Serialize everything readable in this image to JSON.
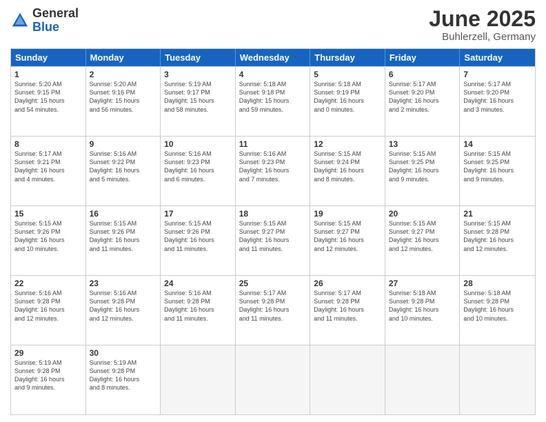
{
  "logo": {
    "general": "General",
    "blue": "Blue"
  },
  "title": "June 2025",
  "location": "Buhlerzell, Germany",
  "days_of_week": [
    "Sunday",
    "Monday",
    "Tuesday",
    "Wednesday",
    "Thursday",
    "Friday",
    "Saturday"
  ],
  "weeks": [
    [
      {
        "day": 1,
        "info": "Sunrise: 5:20 AM\nSunset: 9:15 PM\nDaylight: 15 hours\nand 54 minutes."
      },
      {
        "day": 2,
        "info": "Sunrise: 5:20 AM\nSunset: 9:16 PM\nDaylight: 15 hours\nand 56 minutes."
      },
      {
        "day": 3,
        "info": "Sunrise: 5:19 AM\nSunset: 9:17 PM\nDaylight: 15 hours\nand 58 minutes."
      },
      {
        "day": 4,
        "info": "Sunrise: 5:18 AM\nSunset: 9:18 PM\nDaylight: 15 hours\nand 59 minutes."
      },
      {
        "day": 5,
        "info": "Sunrise: 5:18 AM\nSunset: 9:19 PM\nDaylight: 16 hours\nand 0 minutes."
      },
      {
        "day": 6,
        "info": "Sunrise: 5:17 AM\nSunset: 9:20 PM\nDaylight: 16 hours\nand 2 minutes."
      },
      {
        "day": 7,
        "info": "Sunrise: 5:17 AM\nSunset: 9:20 PM\nDaylight: 16 hours\nand 3 minutes."
      }
    ],
    [
      {
        "day": 8,
        "info": "Sunrise: 5:17 AM\nSunset: 9:21 PM\nDaylight: 16 hours\nand 4 minutes."
      },
      {
        "day": 9,
        "info": "Sunrise: 5:16 AM\nSunset: 9:22 PM\nDaylight: 16 hours\nand 5 minutes."
      },
      {
        "day": 10,
        "info": "Sunrise: 5:16 AM\nSunset: 9:23 PM\nDaylight: 16 hours\nand 6 minutes."
      },
      {
        "day": 11,
        "info": "Sunrise: 5:16 AM\nSunset: 9:23 PM\nDaylight: 16 hours\nand 7 minutes."
      },
      {
        "day": 12,
        "info": "Sunrise: 5:15 AM\nSunset: 9:24 PM\nDaylight: 16 hours\nand 8 minutes."
      },
      {
        "day": 13,
        "info": "Sunrise: 5:15 AM\nSunset: 9:25 PM\nDaylight: 16 hours\nand 9 minutes."
      },
      {
        "day": 14,
        "info": "Sunrise: 5:15 AM\nSunset: 9:25 PM\nDaylight: 16 hours\nand 9 minutes."
      }
    ],
    [
      {
        "day": 15,
        "info": "Sunrise: 5:15 AM\nSunset: 9:26 PM\nDaylight: 16 hours\nand 10 minutes."
      },
      {
        "day": 16,
        "info": "Sunrise: 5:15 AM\nSunset: 9:26 PM\nDaylight: 16 hours\nand 11 minutes."
      },
      {
        "day": 17,
        "info": "Sunrise: 5:15 AM\nSunset: 9:26 PM\nDaylight: 16 hours\nand 11 minutes."
      },
      {
        "day": 18,
        "info": "Sunrise: 5:15 AM\nSunset: 9:27 PM\nDaylight: 16 hours\nand 11 minutes."
      },
      {
        "day": 19,
        "info": "Sunrise: 5:15 AM\nSunset: 9:27 PM\nDaylight: 16 hours\nand 12 minutes."
      },
      {
        "day": 20,
        "info": "Sunrise: 5:15 AM\nSunset: 9:27 PM\nDaylight: 16 hours\nand 12 minutes."
      },
      {
        "day": 21,
        "info": "Sunrise: 5:15 AM\nSunset: 9:28 PM\nDaylight: 16 hours\nand 12 minutes."
      }
    ],
    [
      {
        "day": 22,
        "info": "Sunrise: 5:16 AM\nSunset: 9:28 PM\nDaylight: 16 hours\nand 12 minutes."
      },
      {
        "day": 23,
        "info": "Sunrise: 5:16 AM\nSunset: 9:28 PM\nDaylight: 16 hours\nand 12 minutes."
      },
      {
        "day": 24,
        "info": "Sunrise: 5:16 AM\nSunset: 9:28 PM\nDaylight: 16 hours\nand 11 minutes."
      },
      {
        "day": 25,
        "info": "Sunrise: 5:17 AM\nSunset: 9:28 PM\nDaylight: 16 hours\nand 11 minutes."
      },
      {
        "day": 26,
        "info": "Sunrise: 5:17 AM\nSunset: 9:28 PM\nDaylight: 16 hours\nand 11 minutes."
      },
      {
        "day": 27,
        "info": "Sunrise: 5:18 AM\nSunset: 9:28 PM\nDaylight: 16 hours\nand 10 minutes."
      },
      {
        "day": 28,
        "info": "Sunrise: 5:18 AM\nSunset: 9:28 PM\nDaylight: 16 hours\nand 10 minutes."
      }
    ],
    [
      {
        "day": 29,
        "info": "Sunrise: 5:19 AM\nSunset: 9:28 PM\nDaylight: 16 hours\nand 9 minutes."
      },
      {
        "day": 30,
        "info": "Sunrise: 5:19 AM\nSunset: 9:28 PM\nDaylight: 16 hours\nand 8 minutes."
      },
      {
        "day": null
      },
      {
        "day": null
      },
      {
        "day": null
      },
      {
        "day": null
      },
      {
        "day": null
      }
    ]
  ]
}
